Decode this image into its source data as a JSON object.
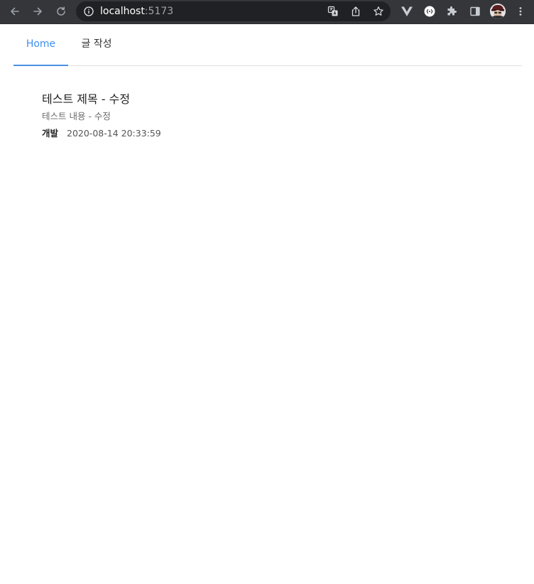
{
  "browser": {
    "url_host": "localhost",
    "url_port": ":5173"
  },
  "nav": {
    "tabs": [
      {
        "label": "Home",
        "active": true
      },
      {
        "label": "글 작성",
        "active": false
      }
    ]
  },
  "posts": [
    {
      "title": "테스트 제목 - 수정",
      "content": "테스트 내용 - 수정",
      "category": "개발",
      "date": "2020-08-14 20:33:59"
    }
  ],
  "colors": {
    "accent": "#3d8ff0",
    "toolbar_bg": "#35363a",
    "omnibox_bg": "#202124"
  }
}
